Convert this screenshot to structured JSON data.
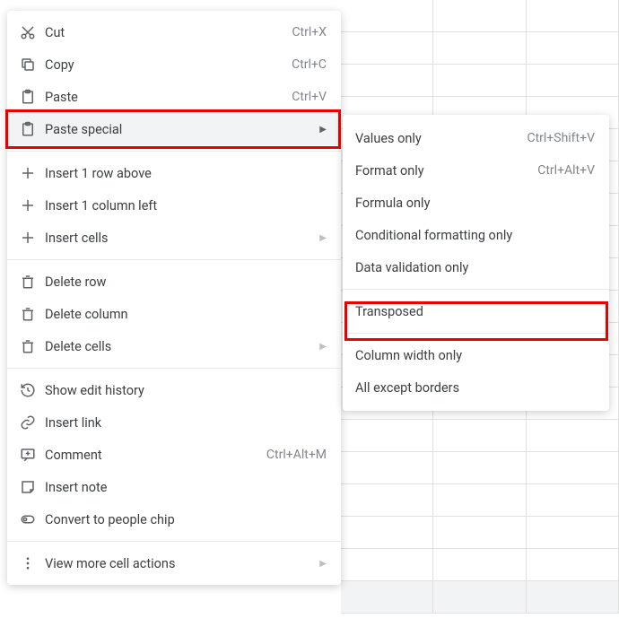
{
  "main_menu": {
    "cut": {
      "label": "Cut",
      "shortcut": "Ctrl+X"
    },
    "copy": {
      "label": "Copy",
      "shortcut": "Ctrl+C"
    },
    "paste": {
      "label": "Paste",
      "shortcut": "Ctrl+V"
    },
    "paste_special": {
      "label": "Paste special"
    },
    "insert_row_above": {
      "label": "Insert 1 row above"
    },
    "insert_col_left": {
      "label": "Insert 1 column left"
    },
    "insert_cells": {
      "label": "Insert cells"
    },
    "delete_row": {
      "label": "Delete row"
    },
    "delete_column": {
      "label": "Delete column"
    },
    "delete_cells": {
      "label": "Delete cells"
    },
    "show_edit_history": {
      "label": "Show edit history"
    },
    "insert_link": {
      "label": "Insert link"
    },
    "comment": {
      "label": "Comment",
      "shortcut": "Ctrl+Alt+M"
    },
    "insert_note": {
      "label": "Insert note"
    },
    "convert_people_chip": {
      "label": "Convert to people chip"
    },
    "view_more": {
      "label": "View more cell actions"
    }
  },
  "submenu": {
    "values_only": {
      "label": "Values only",
      "shortcut": "Ctrl+Shift+V"
    },
    "format_only": {
      "label": "Format only",
      "shortcut": "Ctrl+Alt+V"
    },
    "formula_only": {
      "label": "Formula only"
    },
    "conditional_formatting": {
      "label": "Conditional formatting only"
    },
    "data_validation": {
      "label": "Data validation only"
    },
    "transposed": {
      "label": "Transposed"
    },
    "column_width": {
      "label": "Column width only"
    },
    "all_except_borders": {
      "label": "All except borders"
    }
  }
}
